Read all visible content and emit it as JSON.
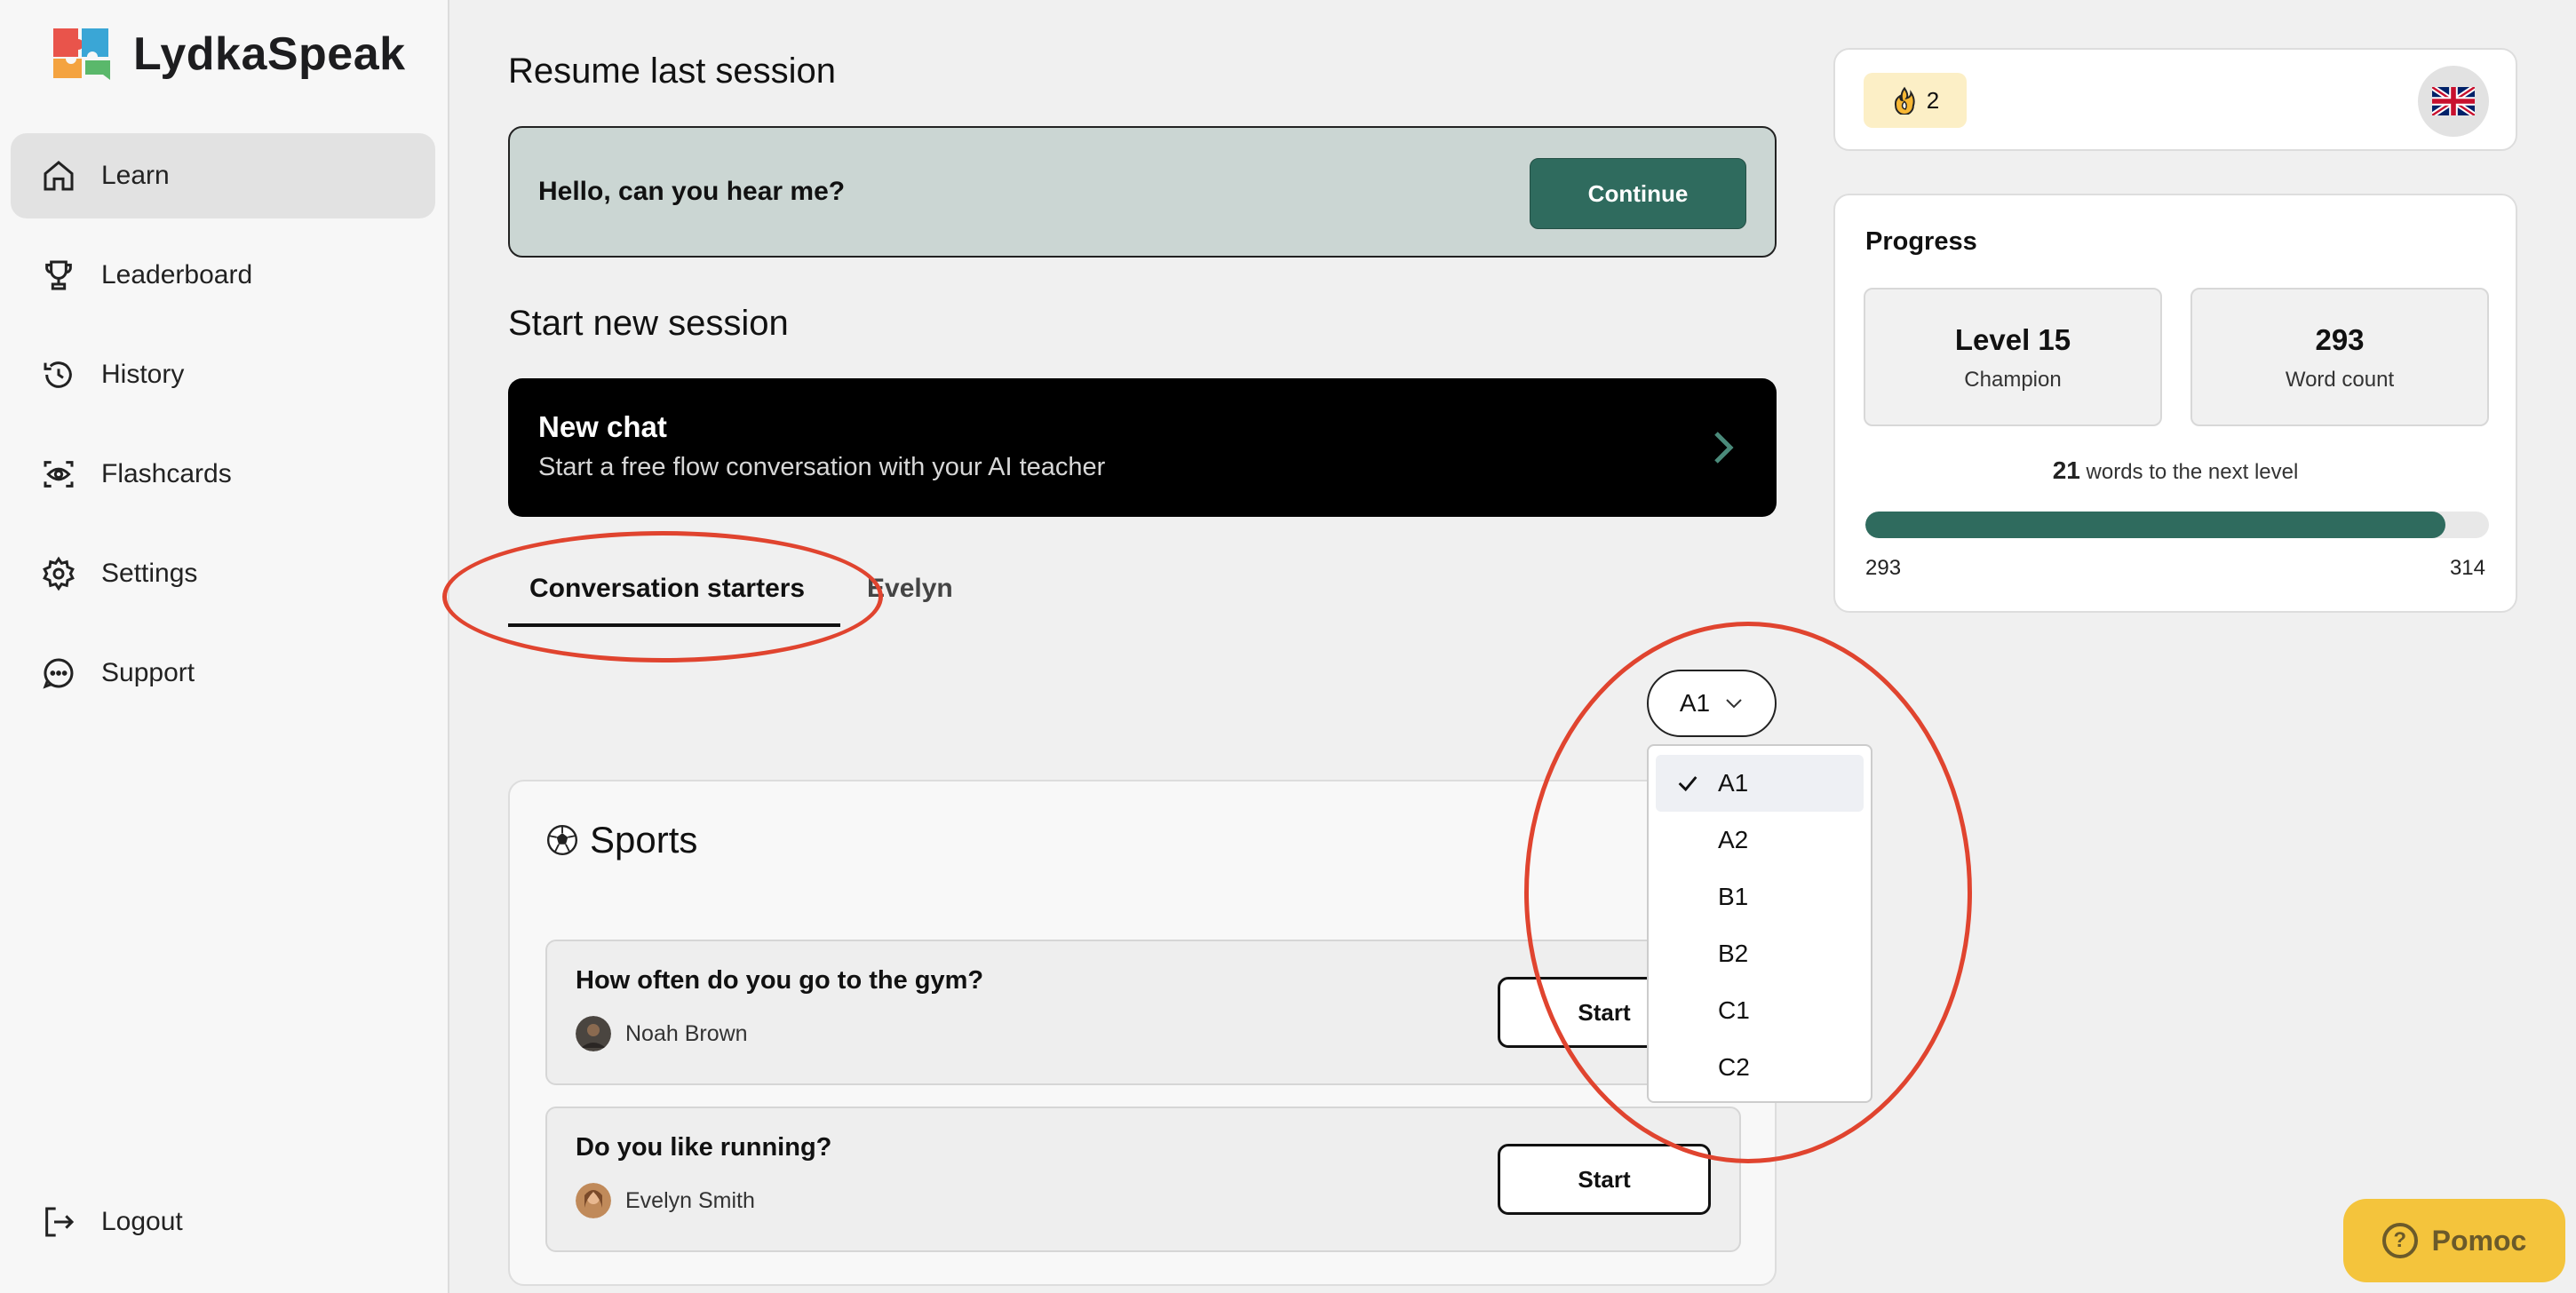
{
  "app": {
    "name": "LydkaSpeak"
  },
  "sidebar": {
    "items": [
      {
        "label": "Learn",
        "icon": "home-icon",
        "active": true
      },
      {
        "label": "Leaderboard",
        "icon": "trophy-icon",
        "active": false
      },
      {
        "label": "History",
        "icon": "history-icon",
        "active": false
      },
      {
        "label": "Flashcards",
        "icon": "eye-scan-icon",
        "active": false
      },
      {
        "label": "Settings",
        "icon": "gear-icon",
        "active": false
      },
      {
        "label": "Support",
        "icon": "chat-bubble-icon",
        "active": false
      }
    ],
    "logout_label": "Logout"
  },
  "resume": {
    "title": "Resume last session",
    "text": "Hello, can you hear me?",
    "button": "Continue"
  },
  "new_session": {
    "title": "Start new session",
    "card_title": "New chat",
    "card_subtitle": "Start a free flow conversation with your AI teacher"
  },
  "tabs": [
    {
      "label": "Conversation starters",
      "active": true
    },
    {
      "label": "Evelyn",
      "active": false
    }
  ],
  "level_select": {
    "value": "A1",
    "options": [
      "A1",
      "A2",
      "B1",
      "B2",
      "C1",
      "C2"
    ]
  },
  "sports": {
    "title": "Sports",
    "questions": [
      {
        "text": "How often do you go to the gym?",
        "author": "Noah Brown",
        "button": "Start"
      },
      {
        "text": "Do you like running?",
        "author": "Evelyn Smith",
        "button": "Start"
      }
    ]
  },
  "streak": {
    "count": "2"
  },
  "progress": {
    "title": "Progress",
    "level_value": "Level 15",
    "level_label": "Champion",
    "word_value": "293",
    "word_label": "Word count",
    "words_to_next": "21",
    "words_to_next_text": "words to the next level",
    "bar_min": "293",
    "bar_max": "314",
    "bar_fraction": 0.93
  },
  "help": {
    "label": "Pomoc"
  },
  "colors": {
    "accent": "#2f6b5e",
    "annotation": "#e0442f",
    "help": "#f4c43c"
  }
}
